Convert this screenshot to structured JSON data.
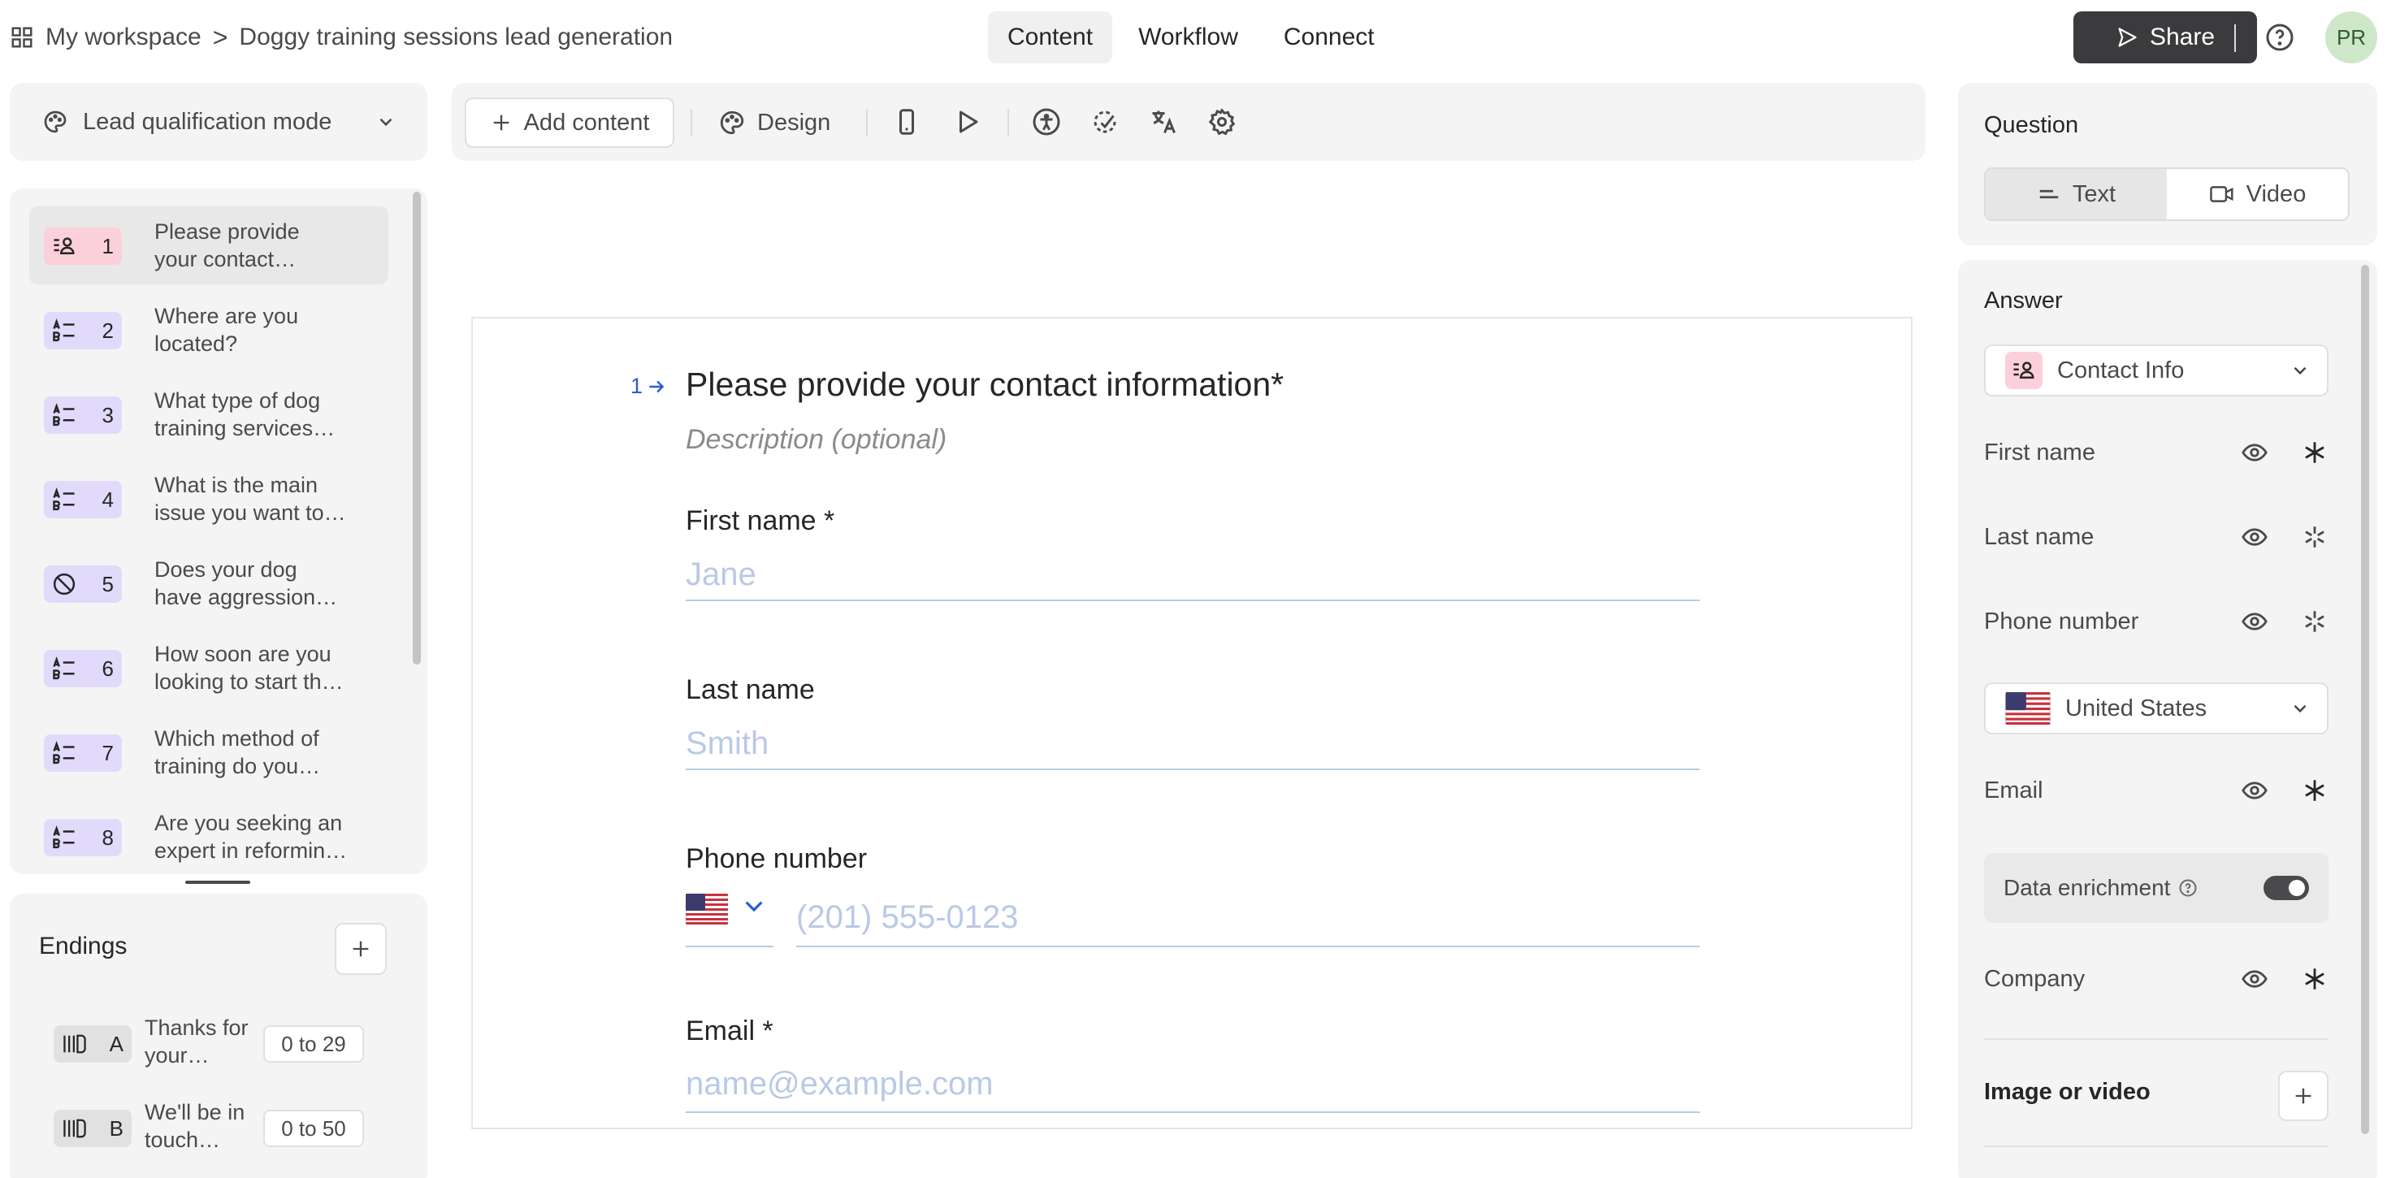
{
  "header": {
    "workspace": "My workspace",
    "separator": ">",
    "form_title": "Doggy training sessions lead generation",
    "tabs": [
      {
        "label": "Content",
        "active": true
      },
      {
        "label": "Workflow",
        "active": false
      },
      {
        "label": "Connect",
        "active": false
      }
    ],
    "share_label": "Share",
    "avatar_initials": "PR"
  },
  "left": {
    "mode_label": "Lead qualification mode",
    "questions": [
      {
        "num": "1",
        "line1": "Please provide",
        "line2": "your contact…",
        "icon": "contact-icon",
        "active": true
      },
      {
        "num": "2",
        "line1": "Where are you",
        "line2": "located?",
        "icon": "multiple-choice-icon",
        "active": false
      },
      {
        "num": "3",
        "line1": "What type of dog",
        "line2": "training services…",
        "icon": "multiple-choice-icon",
        "active": false
      },
      {
        "num": "4",
        "line1": "What is the main",
        "line2": "issue you want to…",
        "icon": "multiple-choice-icon",
        "active": false
      },
      {
        "num": "5",
        "line1": "Does your dog",
        "line2": "have aggression…",
        "icon": "yes-no-icon",
        "active": false
      },
      {
        "num": "6",
        "line1": "How soon are you",
        "line2": "looking to start th…",
        "icon": "multiple-choice-icon",
        "active": false
      },
      {
        "num": "7",
        "line1": "Which method of",
        "line2": "training do you…",
        "icon": "multiple-choice-icon",
        "active": false
      },
      {
        "num": "8",
        "line1": "Are you seeking an",
        "line2": "expert in reformin…",
        "icon": "multiple-choice-icon",
        "active": false
      }
    ],
    "endings_title": "Endings",
    "endings": [
      {
        "letter": "A",
        "line1": "Thanks for",
        "line2": "your…",
        "range": "0 to 29"
      },
      {
        "letter": "B",
        "line1": "We'll be in",
        "line2": "touch…",
        "range": "0 to 50"
      }
    ]
  },
  "toolbar": {
    "add_content": "Add content",
    "design": "Design"
  },
  "canvas": {
    "question_number": "1",
    "question_title": "Please provide your contact information*",
    "description_placeholder": "Description (optional)",
    "fields": [
      {
        "label": "First name *",
        "placeholder": "Jane"
      },
      {
        "label": "Last name",
        "placeholder": "Smith"
      },
      {
        "label": "Phone number",
        "placeholder": "(201) 555-0123"
      },
      {
        "label": "Email *",
        "placeholder": "name@example.com"
      }
    ]
  },
  "right": {
    "question_title": "Question",
    "question_type_options": [
      {
        "label": "Text",
        "active": true
      },
      {
        "label": "Video",
        "active": false
      }
    ],
    "answer_title": "Answer",
    "answer_type": "Contact Info",
    "fields": [
      {
        "label": "First name",
        "required": true
      },
      {
        "label": "Last name",
        "required": false
      },
      {
        "label": "Phone number",
        "required": false
      },
      {
        "label": "Email",
        "required": true
      },
      {
        "label": "Company",
        "required": true
      }
    ],
    "country": "United States",
    "data_enrichment_label": "Data enrichment",
    "data_enrichment_on": true,
    "image_video_title": "Image or video"
  },
  "colors": {
    "accent_blue": "#2a5bd7",
    "share_bg": "#3b3b3d",
    "contact_badge": "#fbd0db",
    "choice_badge": "#e1dafa",
    "placeholder": "#b9c9e6"
  }
}
